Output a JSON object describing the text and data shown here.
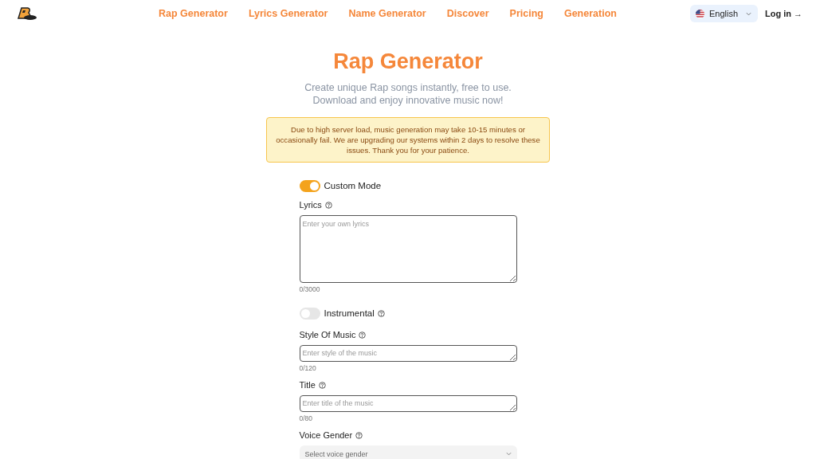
{
  "nav": {
    "links": [
      {
        "label": "Rap Generator"
      },
      {
        "label": "Lyrics Generator"
      },
      {
        "label": "Name Generator"
      },
      {
        "label": "Discover"
      },
      {
        "label": "Pricing"
      },
      {
        "label": "Generation"
      }
    ],
    "language": "English",
    "login": "Log in →"
  },
  "hero": {
    "title": "Rap Generator",
    "subtitle": [
      "Create unique Rap songs instantly, free to use.",
      "Download and enjoy innovative music now!"
    ]
  },
  "notice": "Due to high server load, music generation may take 10-15 minutes or occasionally fail. We are upgrading our systems within 2 days to resolve these issues. Thank you for your patience.",
  "form": [
    {
      "kind": "toggle",
      "label": "Custom Mode",
      "on": true,
      "help": false
    },
    {
      "kind": "textarea",
      "label": "Lyrics",
      "placeholder": "Enter your own lyrics",
      "count": "0/3000"
    },
    {
      "kind": "toggle",
      "label": "Instrumental",
      "on": false,
      "help": true
    },
    {
      "kind": "input",
      "label": "Style Of Music",
      "placeholder": "Enter style of the music",
      "count": "0/120"
    },
    {
      "kind": "input",
      "label": "Title",
      "placeholder": "Enter title of the music",
      "count": "0/80"
    },
    {
      "kind": "select",
      "label": "Voice Gender",
      "placeholder": "Select voice gender"
    }
  ]
}
